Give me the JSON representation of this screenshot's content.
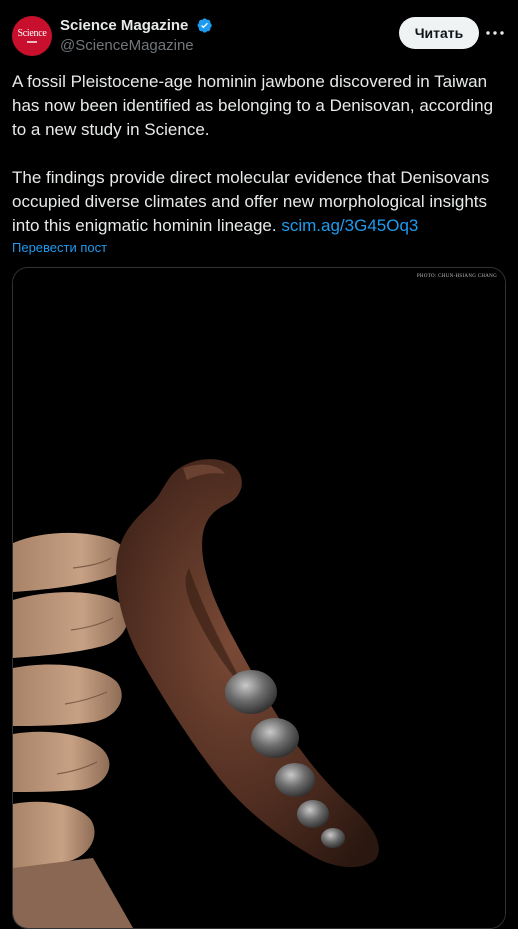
{
  "author": {
    "display_name": "Science Magazine",
    "handle": "@ScienceMagazine",
    "avatar_text": "Science",
    "verified": true,
    "verified_color": "#1d9bf0",
    "avatar_color": "#c8102e"
  },
  "actions": {
    "follow_label": "Читать",
    "more_icon": "more-horizontal-icon"
  },
  "tweet": {
    "paragraph1": "A fossil Pleistocene-age hominin jawbone discovered in Taiwan has now been identified as belonging to a Denisovan, according to a new study in Science.",
    "paragraph2": "The findings provide direct molecular evidence that Denisovans occupied diverse climates and offer new morphological insights into this enigmatic hominin lineage.",
    "link_text": "scim.ag/3G45Oq3",
    "link_color": "#1d9bf0"
  },
  "translate_label": "Перевести пост",
  "media": {
    "photo_credit": "PHOTO: CHUN-HSIANG CHANG",
    "subject": "hand holding fossil jawbone"
  }
}
